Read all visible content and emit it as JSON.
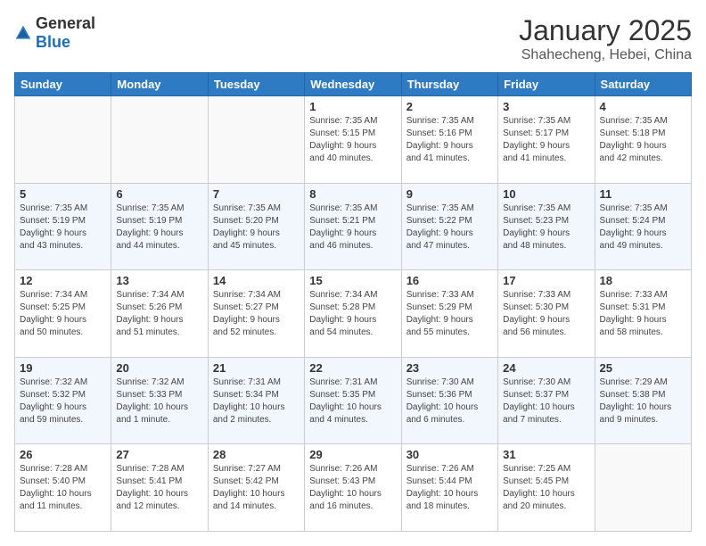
{
  "header": {
    "logo_general": "General",
    "logo_blue": "Blue",
    "title": "January 2025",
    "subtitle": "Shahecheng, Hebei, China"
  },
  "weekdays": [
    "Sunday",
    "Monday",
    "Tuesday",
    "Wednesday",
    "Thursday",
    "Friday",
    "Saturday"
  ],
  "weeks": [
    [
      {
        "day": "",
        "info": ""
      },
      {
        "day": "",
        "info": ""
      },
      {
        "day": "",
        "info": ""
      },
      {
        "day": "1",
        "info": "Sunrise: 7:35 AM\nSunset: 5:15 PM\nDaylight: 9 hours\nand 40 minutes."
      },
      {
        "day": "2",
        "info": "Sunrise: 7:35 AM\nSunset: 5:16 PM\nDaylight: 9 hours\nand 41 minutes."
      },
      {
        "day": "3",
        "info": "Sunrise: 7:35 AM\nSunset: 5:17 PM\nDaylight: 9 hours\nand 41 minutes."
      },
      {
        "day": "4",
        "info": "Sunrise: 7:35 AM\nSunset: 5:18 PM\nDaylight: 9 hours\nand 42 minutes."
      }
    ],
    [
      {
        "day": "5",
        "info": "Sunrise: 7:35 AM\nSunset: 5:19 PM\nDaylight: 9 hours\nand 43 minutes."
      },
      {
        "day": "6",
        "info": "Sunrise: 7:35 AM\nSunset: 5:19 PM\nDaylight: 9 hours\nand 44 minutes."
      },
      {
        "day": "7",
        "info": "Sunrise: 7:35 AM\nSunset: 5:20 PM\nDaylight: 9 hours\nand 45 minutes."
      },
      {
        "day": "8",
        "info": "Sunrise: 7:35 AM\nSunset: 5:21 PM\nDaylight: 9 hours\nand 46 minutes."
      },
      {
        "day": "9",
        "info": "Sunrise: 7:35 AM\nSunset: 5:22 PM\nDaylight: 9 hours\nand 47 minutes."
      },
      {
        "day": "10",
        "info": "Sunrise: 7:35 AM\nSunset: 5:23 PM\nDaylight: 9 hours\nand 48 minutes."
      },
      {
        "day": "11",
        "info": "Sunrise: 7:35 AM\nSunset: 5:24 PM\nDaylight: 9 hours\nand 49 minutes."
      }
    ],
    [
      {
        "day": "12",
        "info": "Sunrise: 7:34 AM\nSunset: 5:25 PM\nDaylight: 9 hours\nand 50 minutes."
      },
      {
        "day": "13",
        "info": "Sunrise: 7:34 AM\nSunset: 5:26 PM\nDaylight: 9 hours\nand 51 minutes."
      },
      {
        "day": "14",
        "info": "Sunrise: 7:34 AM\nSunset: 5:27 PM\nDaylight: 9 hours\nand 52 minutes."
      },
      {
        "day": "15",
        "info": "Sunrise: 7:34 AM\nSunset: 5:28 PM\nDaylight: 9 hours\nand 54 minutes."
      },
      {
        "day": "16",
        "info": "Sunrise: 7:33 AM\nSunset: 5:29 PM\nDaylight: 9 hours\nand 55 minutes."
      },
      {
        "day": "17",
        "info": "Sunrise: 7:33 AM\nSunset: 5:30 PM\nDaylight: 9 hours\nand 56 minutes."
      },
      {
        "day": "18",
        "info": "Sunrise: 7:33 AM\nSunset: 5:31 PM\nDaylight: 9 hours\nand 58 minutes."
      }
    ],
    [
      {
        "day": "19",
        "info": "Sunrise: 7:32 AM\nSunset: 5:32 PM\nDaylight: 9 hours\nand 59 minutes."
      },
      {
        "day": "20",
        "info": "Sunrise: 7:32 AM\nSunset: 5:33 PM\nDaylight: 10 hours\nand 1 minute."
      },
      {
        "day": "21",
        "info": "Sunrise: 7:31 AM\nSunset: 5:34 PM\nDaylight: 10 hours\nand 2 minutes."
      },
      {
        "day": "22",
        "info": "Sunrise: 7:31 AM\nSunset: 5:35 PM\nDaylight: 10 hours\nand 4 minutes."
      },
      {
        "day": "23",
        "info": "Sunrise: 7:30 AM\nSunset: 5:36 PM\nDaylight: 10 hours\nand 6 minutes."
      },
      {
        "day": "24",
        "info": "Sunrise: 7:30 AM\nSunset: 5:37 PM\nDaylight: 10 hours\nand 7 minutes."
      },
      {
        "day": "25",
        "info": "Sunrise: 7:29 AM\nSunset: 5:38 PM\nDaylight: 10 hours\nand 9 minutes."
      }
    ],
    [
      {
        "day": "26",
        "info": "Sunrise: 7:28 AM\nSunset: 5:40 PM\nDaylight: 10 hours\nand 11 minutes."
      },
      {
        "day": "27",
        "info": "Sunrise: 7:28 AM\nSunset: 5:41 PM\nDaylight: 10 hours\nand 12 minutes."
      },
      {
        "day": "28",
        "info": "Sunrise: 7:27 AM\nSunset: 5:42 PM\nDaylight: 10 hours\nand 14 minutes."
      },
      {
        "day": "29",
        "info": "Sunrise: 7:26 AM\nSunset: 5:43 PM\nDaylight: 10 hours\nand 16 minutes."
      },
      {
        "day": "30",
        "info": "Sunrise: 7:26 AM\nSunset: 5:44 PM\nDaylight: 10 hours\nand 18 minutes."
      },
      {
        "day": "31",
        "info": "Sunrise: 7:25 AM\nSunset: 5:45 PM\nDaylight: 10 hours\nand 20 minutes."
      },
      {
        "day": "",
        "info": ""
      }
    ]
  ]
}
